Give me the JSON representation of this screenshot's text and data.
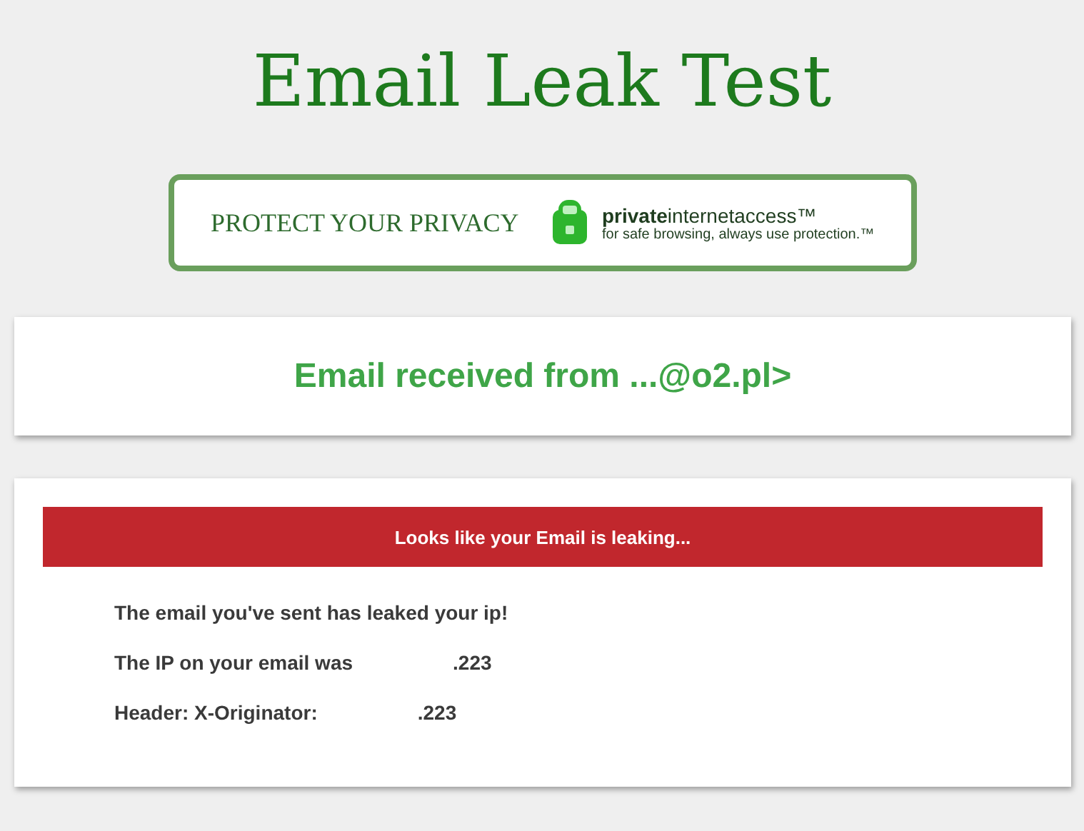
{
  "title": "Email Leak Test",
  "ad": {
    "slogan": "PROTECT YOUR PRIVACY",
    "brand": "**private**internetaccess™",
    "tagline": "for safe browsing, always use protection.™"
  },
  "received": {
    "text": "Email received from ...@o2.pl>"
  },
  "result": {
    "banner": "Looks like your Email is leaking...",
    "message": "The email you've sent has leaked your ip!",
    "details": [
      {
        "label": "The IP on your email was",
        "value": ".223"
      },
      {
        "label": "Header: X-Originator:",
        "value": ".223"
      }
    ]
  }
}
